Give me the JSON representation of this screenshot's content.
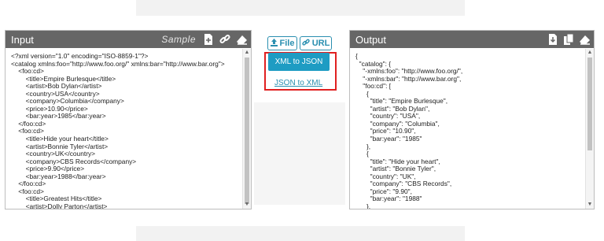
{
  "input": {
    "title": "Input",
    "sample_label": "Sample",
    "code": "<?xml version=\"1.0\" encoding=\"ISO-8859-1\"?>\n<catalog xmlns:foo=\"http://www.foo.org/\" xmlns:bar=\"http://www.bar.org\">\n    <foo:cd>\n        <title>Empire Burlesque</title>\n        <artist>Bob Dylan</artist>\n        <country>USA</country>\n        <company>Columbia</company>\n        <price>10.90</price>\n        <bar:year>1985</bar:year>\n    </foo:cd>\n    <foo:cd>\n        <title>Hide your heart</title>\n        <artist>Bonnie Tyler</artist>\n        <country>UK</country>\n        <company>CBS Records</company>\n        <price>9.90</price>\n        <bar:year>1988</bar:year>\n    </foo:cd>\n    <foo:cd>\n        <title>Greatest Hits</title>\n        <artist>Dolly Parton</artist>\n        <country>USA</country>\n        <company>RCA</company>"
  },
  "controls": {
    "file_label": "File",
    "url_label": "URL",
    "xml_to_json_label": "XML to JSON",
    "json_to_xml_label": "JSON to XML"
  },
  "output": {
    "title": "Output",
    "code": "{\n  \"catalog\": {\n    \"-xmlns:foo\": \"http://www.foo.org/\",\n    \"-xmlns:bar\": \"http://www.bar.org\",\n    \"foo:cd\": [\n      {\n        \"title\": \"Empire Burlesque\",\n        \"artist\": \"Bob Dylan\",\n        \"country\": \"USA\",\n        \"company\": \"Columbia\",\n        \"price\": \"10.90\",\n        \"bar:year\": \"1985\"\n      },\n      {\n        \"title\": \"Hide your heart\",\n        \"artist\": \"Bonnie Tyler\",\n        \"country\": \"UK\",\n        \"company\": \"CBS Records\",\n        \"price\": \"9.90\",\n        \"bar:year\": \"1988\"\n      },\n      {\n        \"title\": \"Greatest Hits\","
  },
  "icons": {
    "input_header": [
      "new-file-icon",
      "link-icon",
      "eraser-icon"
    ],
    "output_header": [
      "download-icon",
      "copy-icon",
      "eraser-icon"
    ],
    "file_button": "upload-icon",
    "url_button": "link-icon"
  },
  "colors": {
    "header_bg": "#666666",
    "accent": "#1e9cc3",
    "highlight": "#e02020"
  }
}
